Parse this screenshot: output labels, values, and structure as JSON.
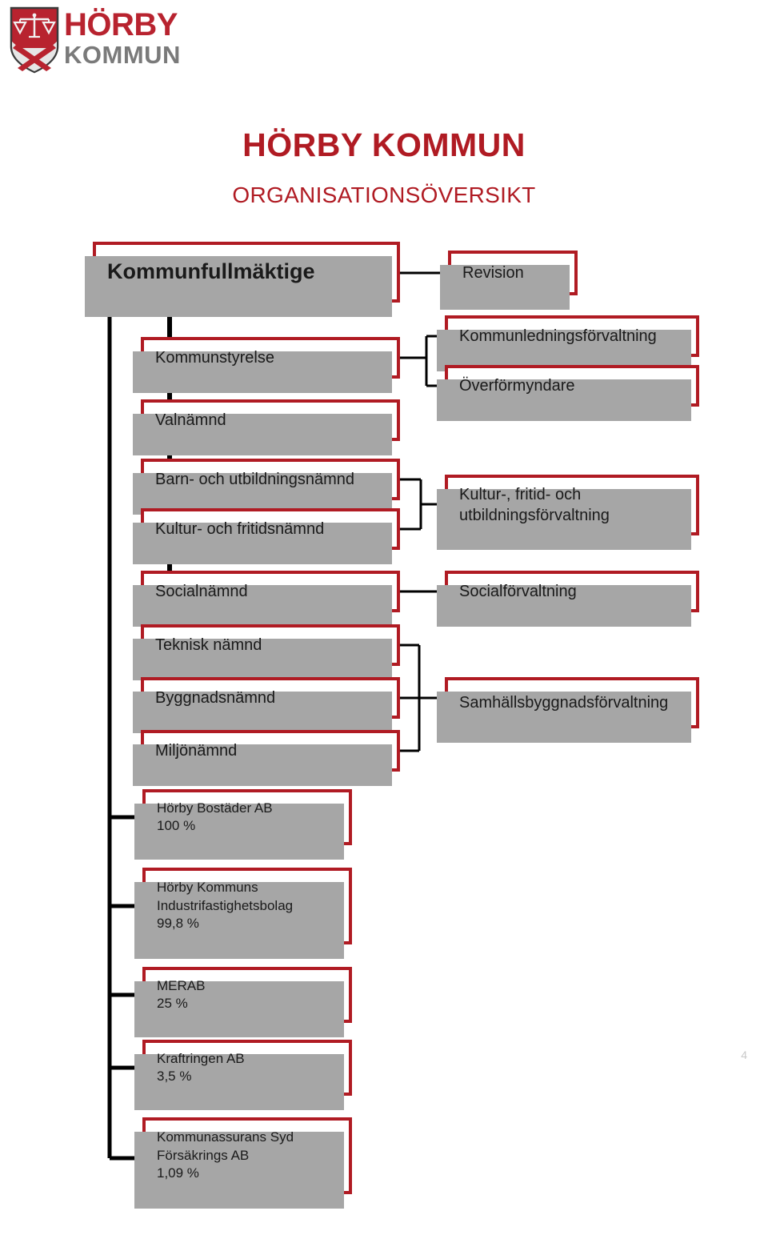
{
  "logo": {
    "crest_icon": "coat-of-arms-shield-icon",
    "wordmark_line1": "HÖRBY",
    "wordmark_line2": "KOMMUN",
    "brand_red": "#B8232F",
    "wordmark_gray": "#7A7A7A"
  },
  "header": {
    "title": "HÖRBY KOMMUN",
    "subtitle": "ORGANISATIONSÖVERSIKT",
    "title_color": "#B01B23"
  },
  "theme": {
    "node_border": "#B01B23",
    "node_fill": "#FFFFFF",
    "shadow": "#A6A6A6",
    "connector": "#000000",
    "text": "#1A1A1A"
  },
  "chart_data": {
    "type": "diagram",
    "title": "HÖRBY KOMMUN ORGANISATIONSÖVERSIKT",
    "nodes": [
      {
        "id": "kommunfullmaktige",
        "label": "Kommunfullmäktige",
        "column": "left",
        "level": 0
      },
      {
        "id": "revision",
        "label": "Revision",
        "column": "right",
        "level": 0
      },
      {
        "id": "kommunstyrelse",
        "label": "Kommunstyrelse",
        "column": "left",
        "level": 1
      },
      {
        "id": "valnamnd",
        "label": "Valnämnd",
        "column": "left",
        "level": 2
      },
      {
        "id": "kommunledningsforvaltning",
        "label": "Kommunledningsförvaltning",
        "column": "right",
        "level": 1
      },
      {
        "id": "overformyndare",
        "label": "Överförmyndare",
        "column": "right",
        "level": 2
      },
      {
        "id": "barn-och-utbildningsnamnd",
        "label": "Barn- och utbildningsnämnd",
        "column": "left",
        "level": 3
      },
      {
        "id": "kultur-och-fritidsnamnd",
        "label": "Kultur- och fritidsnämnd",
        "column": "left",
        "level": 4
      },
      {
        "id": "kultur-fritid-utbildningsforvaltning",
        "label": "Kultur-, fritid- och\nutbildningsförvaltning",
        "column": "right",
        "level": 3
      },
      {
        "id": "socialnamnd",
        "label": "Socialnämnd",
        "column": "left",
        "level": 5
      },
      {
        "id": "socialforvaltning",
        "label": "Socialförvaltning",
        "column": "right",
        "level": 5
      },
      {
        "id": "teknisk-namnd",
        "label": "Teknisk nämnd",
        "column": "left",
        "level": 6
      },
      {
        "id": "byggnadsnamnd",
        "label": "Byggnadsnämnd",
        "column": "left",
        "level": 7
      },
      {
        "id": "miljonamnd",
        "label": "Miljönämnd",
        "column": "left",
        "level": 8
      },
      {
        "id": "samhallsbyggnadsforvaltning",
        "label": "Samhällsbyggnadsförvaltning",
        "column": "right",
        "level": 7
      },
      {
        "id": "horby-bostader",
        "label": "Hörby Bostäder AB\n100 %",
        "column": "companies",
        "level": 9,
        "ownership": "100 %"
      },
      {
        "id": "horby-industrifastighetsbolag",
        "label": "Hörby Kommuns\nIndustrifastighetsbolag\n99,8 %",
        "column": "companies",
        "level": 10,
        "ownership": "99,8 %"
      },
      {
        "id": "merab",
        "label": "MERAB\n25 %",
        "column": "companies",
        "level": 11,
        "ownership": "25 %"
      },
      {
        "id": "kraftringen",
        "label": "Kraftringen AB\n3,5 %",
        "column": "companies",
        "level": 12,
        "ownership": "3,5 %"
      },
      {
        "id": "kommunassurans",
        "label": "Kommunassurans Syd\nFörsäkrings AB\n1,09 %",
        "column": "companies",
        "level": 13,
        "ownership": "1,09 %"
      }
    ],
    "edges": [
      {
        "from": "kommunfullmaktige",
        "to": "revision",
        "style": "arrow"
      },
      {
        "from": "kommunfullmaktige",
        "to": "kommunstyrelse",
        "style": "line"
      },
      {
        "from": "kommunfullmaktige",
        "to": "valnamnd",
        "style": "line"
      },
      {
        "from": "kommunfullmaktige",
        "to": "barn-och-utbildningsnamnd",
        "style": "line"
      },
      {
        "from": "kommunfullmaktige",
        "to": "kultur-och-fritidsnamnd",
        "style": "line"
      },
      {
        "from": "kommunfullmaktige",
        "to": "socialnamnd",
        "style": "line"
      },
      {
        "from": "kommunfullmaktige",
        "to": "teknisk-namnd",
        "style": "line"
      },
      {
        "from": "kommunfullmaktige",
        "to": "byggnadsnamnd",
        "style": "line"
      },
      {
        "from": "kommunfullmaktige",
        "to": "miljonamnd",
        "style": "line"
      },
      {
        "from": "kommunstyrelse",
        "to": "kommunledningsforvaltning",
        "style": "arrow"
      },
      {
        "from": "kommunstyrelse",
        "to": "overformyndare",
        "style": "arrow"
      },
      {
        "from": "barn-och-utbildningsnamnd",
        "to": "kultur-fritid-utbildningsforvaltning",
        "style": "arrow"
      },
      {
        "from": "kultur-och-fritidsnamnd",
        "to": "kultur-fritid-utbildningsforvaltning",
        "style": "arrow"
      },
      {
        "from": "socialnamnd",
        "to": "socialforvaltning",
        "style": "arrow"
      },
      {
        "from": "teknisk-namnd",
        "to": "samhallsbyggnadsforvaltning",
        "style": "arrow"
      },
      {
        "from": "byggnadsnamnd",
        "to": "samhallsbyggnadsforvaltning",
        "style": "arrow"
      },
      {
        "from": "miljonamnd",
        "to": "samhallsbyggnadsforvaltning",
        "style": "arrow"
      },
      {
        "from": "kommunfullmaktige",
        "to": "horby-bostader",
        "style": "line"
      },
      {
        "from": "kommunfullmaktige",
        "to": "horby-industrifastighetsbolag",
        "style": "line"
      },
      {
        "from": "kommunfullmaktige",
        "to": "merab",
        "style": "line"
      },
      {
        "from": "kommunfullmaktige",
        "to": "kraftringen",
        "style": "line"
      },
      {
        "from": "kommunfullmaktige",
        "to": "kommunassurans",
        "style": "line"
      }
    ]
  },
  "footer": {
    "page_number": "4"
  }
}
